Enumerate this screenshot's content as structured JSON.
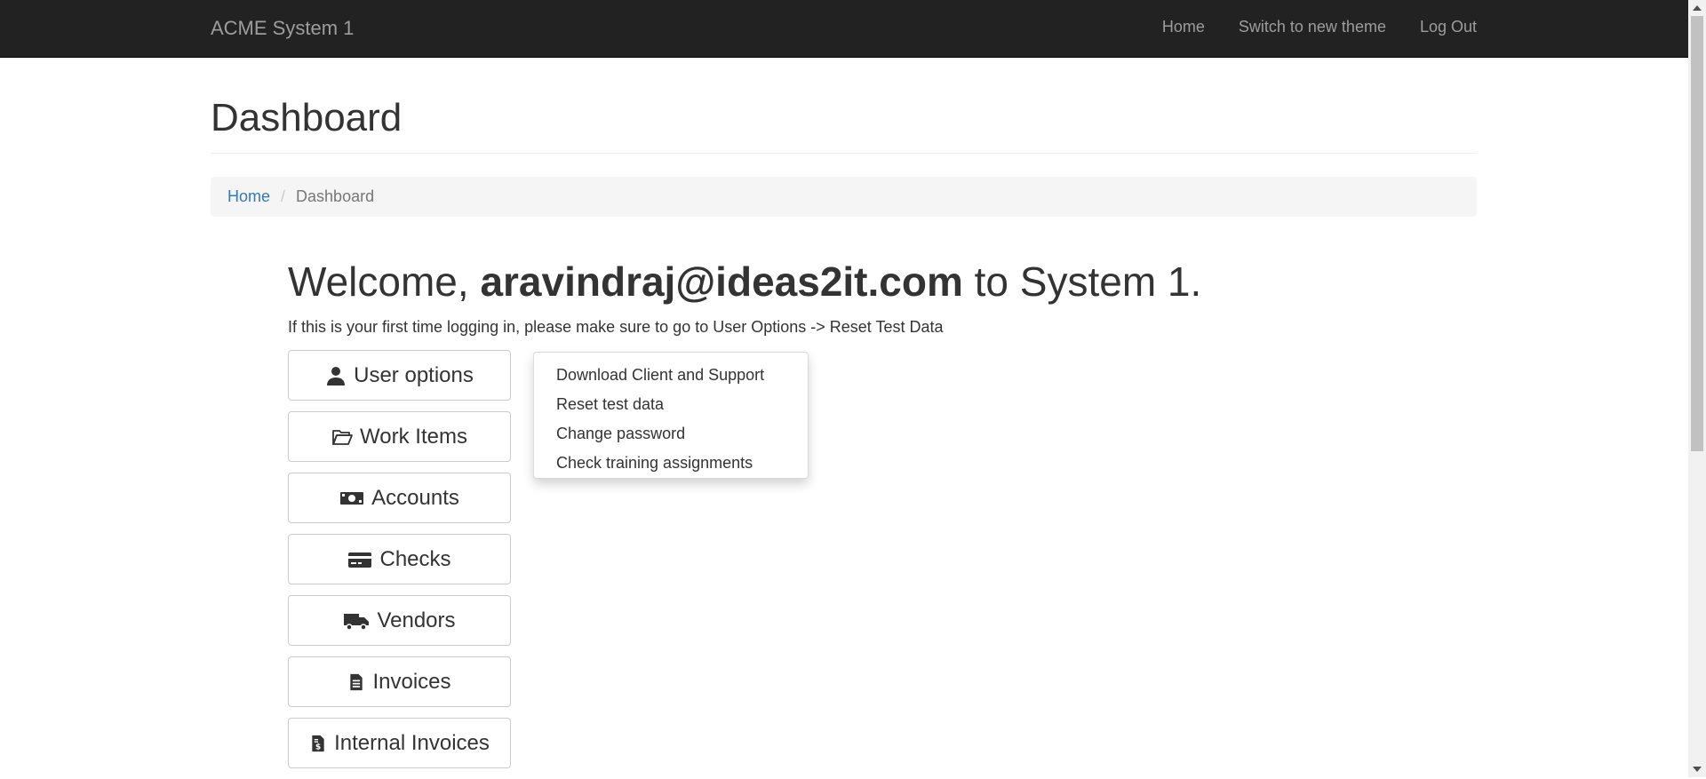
{
  "navbar": {
    "brand": "ACME System 1",
    "links": [
      "Home",
      "Switch to new theme",
      "Log Out"
    ]
  },
  "page": {
    "title": "Dashboard",
    "breadcrumb": {
      "home": "Home",
      "current": "Dashboard"
    }
  },
  "welcome": {
    "prefix": "Welcome, ",
    "user": "aravindraj@ideas2it.com",
    "suffix": " to System 1.",
    "hint": "If this is your first time logging in, please make sure to go to User Options -> Reset Test Data"
  },
  "menu": [
    {
      "label": "User options",
      "icon": "user-icon"
    },
    {
      "label": "Work Items",
      "icon": "folder-open-icon"
    },
    {
      "label": "Accounts",
      "icon": "money-bill-icon"
    },
    {
      "label": "Checks",
      "icon": "credit-card-icon"
    },
    {
      "label": "Vendors",
      "icon": "truck-icon"
    },
    {
      "label": "Invoices",
      "icon": "file-text-icon"
    },
    {
      "label": "Internal Invoices",
      "icon": "file-invoice-dollar-icon"
    }
  ],
  "dropdown": {
    "items": [
      "Download Client and Support",
      "Reset test data",
      "Change password",
      "Check training assignments"
    ]
  }
}
